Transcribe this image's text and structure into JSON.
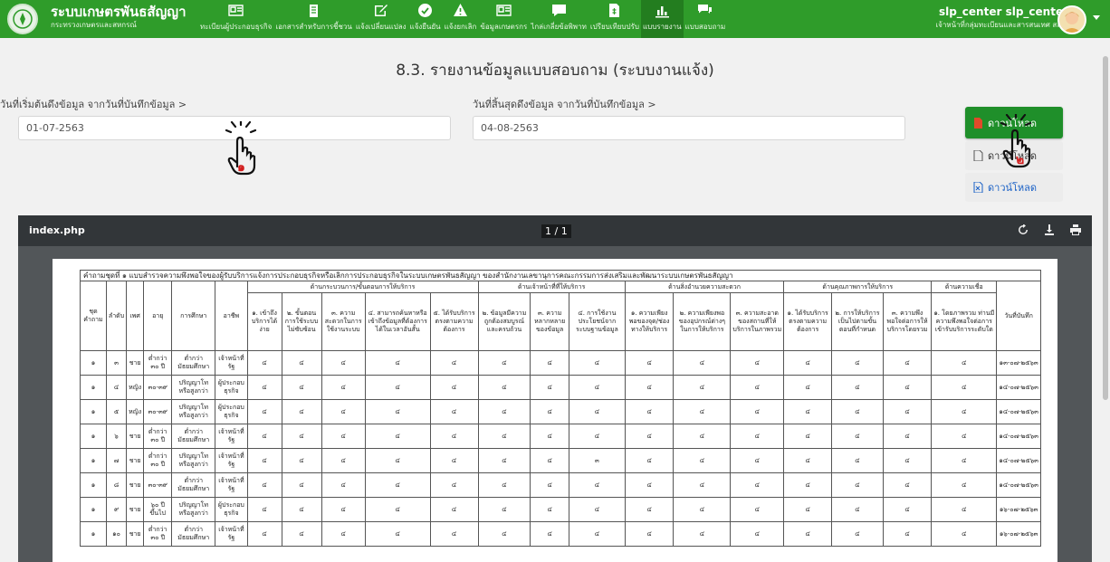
{
  "header": {
    "brand_title": "ระบบเกษตรพันธสัญญา",
    "brand_subtitle": "กระทรวงเกษตรและสหกรณ์",
    "nav": [
      {
        "label": "ทะเบียนผู้ประกอบธุรกิจ",
        "icon": "id-card-icon"
      },
      {
        "label": "เอกสารสำหรับการชี้ชวน",
        "icon": "clipboard-icon"
      },
      {
        "label": "แจ้งเปลี่ยนแปลง",
        "icon": "edit-icon"
      },
      {
        "label": "แจ้งยืนยัน",
        "icon": "check-circle-icon"
      },
      {
        "label": "แจ้งยกเลิก",
        "icon": "warning-icon"
      },
      {
        "label": "ข้อมูลเกษตรกร",
        "icon": "address-card-icon"
      },
      {
        "label": "ไกล่เกลี่ยข้อพิพาท",
        "icon": "comment-icon"
      },
      {
        "label": "เปรียบเทียบปรับ",
        "icon": "document-money-icon"
      },
      {
        "label": "แบบรายงาน",
        "icon": "bar-chart-icon"
      },
      {
        "label": "แบบสอบถาม",
        "icon": "comments-icon"
      }
    ],
    "active_nav": "แบบรายงาน",
    "user_name": "slp_center slp_center",
    "user_role": "เจ้าหน้าที่กลุ่มทะเบียนและสารสนเทศ สลพ."
  },
  "page": {
    "title": "8.3. รายงานข้อมูลแบบสอบถาม (ระบบงานแจ้ง)",
    "start_label": "วันที่เริ่มต้นดึงข้อมูล จากวันที่บันทึกข้อมูล >",
    "start_value": "01-07-2563",
    "end_label": "วันที่สิ้นสุดดึงข้อมูล จากวันที่บันทึกข้อมูล >",
    "end_value": "04-08-2563"
  },
  "download_buttons": [
    {
      "label": "ดาวน์โหลด",
      "icon": "file-pdf-icon",
      "style": "primary"
    },
    {
      "label": "ดาวน์โหลด",
      "icon": "file-icon",
      "style": "plain"
    },
    {
      "label": "ดาวน์โหลด",
      "icon": "file-excel-icon",
      "style": "plain"
    }
  ],
  "annotations": {
    "step1": "๑",
    "step2": "๒"
  },
  "colors": {
    "primary_green": "#2f9c2a",
    "button_green": "#1f8f2a",
    "viewer_bar": "#323639"
  },
  "viewer": {
    "file_name": "index.php",
    "page_indicator": "1 / 1",
    "actions": [
      "reload-icon",
      "download-icon",
      "print-icon"
    ]
  },
  "report": {
    "caption": "คำถามชุดที่ ๑ แบบสำรวจความพึงพอใจของผู้รับบริการแจ้งการประกอบธุรกิจหรือเลิกการประกอบธุรกิจในระบบเกษตรพันธสัญญา ของสำนักงานเลขานุการคณะกรรมการส่งเสริมและพัฒนาระบบเกษตรพันธสัญญา",
    "base_headers": [
      "ชุดคำถาม",
      "ลำดับ",
      "เพศ",
      "อายุ",
      "การศึกษา",
      "อาชีพ"
    ],
    "groups": [
      {
        "label": "ด้านกระบวนการ/ขั้นตอนการให้บริการ",
        "cols": [
          "๑. เข้าถึงบริการได้ง่าย",
          "๒. ขั้นตอนการใช้ระบบไม่ซับซ้อน",
          "๓. ความสะดวกในการใช้งานระบบ",
          "๔. สามารถค้นหาหรือเข้าถึงข้อมูลที่ต้องการได้ในเวลาอันสั้น",
          "๕. ได้รับบริการตรงตามความต้องการ"
        ]
      },
      {
        "label": "ด้านเจ้าหน้าที่ที่ให้บริการ",
        "cols": [
          "๒. ข้อมูลมีความถูกต้องสมบูรณ์และครบถ้วน",
          "๓. ความหลากหลายของข้อมูล",
          "๔. การใช้งานประโยชน์จากระบบฐานข้อมูล"
        ]
      },
      {
        "label": "ด้านสิ่งอำนวยความสะดวก",
        "cols": [
          "๑. ความเพียงพอของจุด/ช่องทางให้บริการ",
          "๒. ความเพียงพอของอุปกรณ์ต่างๆ ในการให้บริการ",
          "๓. ความสะอาดของสถานที่ให้บริการในภาพรวม"
        ]
      },
      {
        "label": "ด้านคุณภาพการให้บริการ",
        "cols": [
          "๑. ได้รับบริการตรงตามความต้องการ",
          "๒. การให้บริการเป็นไปตามขั้นตอนที่กำหนด",
          "๓. ความพึงพอใจต่อการให้บริการโดยรวม"
        ]
      },
      {
        "label": "ด้านความเชื่อ",
        "cols": [
          "๑. โดยภาพรวม ท่านมีความพึงพอใจต่อการเข้ารับบริการระดับใด"
        ]
      }
    ],
    "date_header": "วันที่บันทึก",
    "rows": [
      {
        "set": "๑",
        "no": "๓",
        "sex": "ชาย",
        "age": "ต่ำกว่า ๓๐ ปี",
        "edu": "ต่ำกว่ามัธยมศึกษา",
        "job": "เจ้าหน้าที่รัฐ",
        "scores": [
          "๔",
          "๔",
          "๔",
          "๔",
          "๔",
          "๔",
          "๔",
          "๔",
          "๔",
          "๔",
          "๔",
          "๔",
          "๔",
          "๔",
          "๔"
        ],
        "date": "๑๓-๐๗-๒๕๖๓"
      },
      {
        "set": "๑",
        "no": "๔",
        "sex": "หญิง",
        "age": "๓๐-๓๙",
        "edu": "ปริญญาโทหรือสูงกว่า",
        "job": "ผู้ประกอบธุรกิจ",
        "scores": [
          "๔",
          "๔",
          "๔",
          "๔",
          "๔",
          "๔",
          "๔",
          "๔",
          "๔",
          "๔",
          "๔",
          "๔",
          "๔",
          "๔",
          "๔"
        ],
        "date": "๑๔-๐๗-๒๕๖๓"
      },
      {
        "set": "๑",
        "no": "๕",
        "sex": "หญิง",
        "age": "๓๐-๓๙",
        "edu": "ปริญญาโทหรือสูงกว่า",
        "job": "ผู้ประกอบธุรกิจ",
        "scores": [
          "๔",
          "๔",
          "๔",
          "๔",
          "๔",
          "๔",
          "๔",
          "๔",
          "๔",
          "๔",
          "๔",
          "๔",
          "๔",
          "๔",
          "๔"
        ],
        "date": "๑๔-๐๗-๒๕๖๓"
      },
      {
        "set": "๑",
        "no": "๖",
        "sex": "ชาย",
        "age": "ต่ำกว่า ๓๐ ปี",
        "edu": "ต่ำกว่ามัธยมศึกษา",
        "job": "เจ้าหน้าที่รัฐ",
        "scores": [
          "๔",
          "๔",
          "๔",
          "๔",
          "๔",
          "๔",
          "๔",
          "๔",
          "๔",
          "๔",
          "๔",
          "๔",
          "๔",
          "๔",
          "๔"
        ],
        "date": "๑๔-๐๗-๒๕๖๓"
      },
      {
        "set": "๑",
        "no": "๗",
        "sex": "ชาย",
        "age": "ต่ำกว่า ๓๐ ปี",
        "edu": "ปริญญาโทหรือสูงกว่า",
        "job": "เจ้าหน้าที่รัฐ",
        "scores": [
          "๔",
          "๔",
          "๔",
          "๔",
          "๔",
          "๔",
          "๔",
          "๓",
          "๔",
          "๔",
          "๔",
          "๔",
          "๔",
          "๔",
          "๔"
        ],
        "date": "๑๔-๐๗-๒๕๖๓"
      },
      {
        "set": "๑",
        "no": "๘",
        "sex": "ชาย",
        "age": "๓๐-๓๙",
        "edu": "ต่ำกว่ามัธยมศึกษา",
        "job": "เจ้าหน้าที่รัฐ",
        "scores": [
          "๔",
          "๔",
          "๔",
          "๔",
          "๔",
          "๔",
          "๔",
          "๔",
          "๔",
          "๔",
          "๔",
          "๔",
          "๔",
          "๔",
          "๔"
        ],
        "date": "๑๔-๐๗-๒๕๖๓"
      },
      {
        "set": "๑",
        "no": "๙",
        "sex": "ชาย",
        "age": "๖๐ ปี ขึ้นไป",
        "edu": "ปริญญาโทหรือสูงกว่า",
        "job": "ผู้ประกอบธุรกิจ",
        "scores": [
          "๔",
          "๔",
          "๔",
          "๔",
          "๔",
          "๔",
          "๔",
          "๔",
          "๔",
          "๔",
          "๔",
          "๔",
          "๔",
          "๔",
          "๔"
        ],
        "date": "๑๖-๐๗-๒๕๖๓"
      },
      {
        "set": "๑",
        "no": "๑๐",
        "sex": "ชาย",
        "age": "ต่ำกว่า ๓๐ ปี",
        "edu": "ต่ำกว่ามัธยมศึกษา",
        "job": "เจ้าหน้าที่รัฐ",
        "scores": [
          "๔",
          "๔",
          "๔",
          "๔",
          "๔",
          "๔",
          "๔",
          "๔",
          "๔",
          "๔",
          "๔",
          "๔",
          "๔",
          "๔",
          "๔"
        ],
        "date": "๑๖-๐๗-๒๕๖๓"
      }
    ]
  }
}
